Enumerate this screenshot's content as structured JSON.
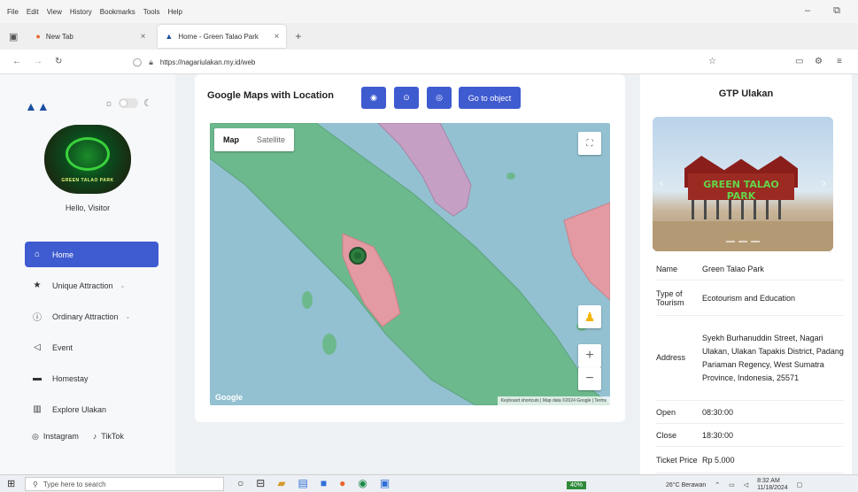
{
  "browser": {
    "menu": [
      "File",
      "Edit",
      "View",
      "History",
      "Bookmarks",
      "Tools",
      "Help"
    ],
    "tabs": [
      {
        "label": "New Tab",
        "active": false
      },
      {
        "label": "Home - Green Talao Park",
        "active": true
      }
    ],
    "url": "https://nagariulakan.my.id/web"
  },
  "sidebar": {
    "greeting": "Hello, Visitor",
    "avatar_text": "GREEN TALAO PARK",
    "nav": [
      {
        "label": "Home",
        "icon": "home-icon",
        "active": true
      },
      {
        "label": "Unique Attraction",
        "icon": "star-icon",
        "has_submenu": true
      },
      {
        "label": "Ordinary Attraction",
        "icon": "info-icon",
        "has_submenu": true
      },
      {
        "label": "Event",
        "icon": "megaphone-icon"
      },
      {
        "label": "Homestay",
        "icon": "bed-icon"
      },
      {
        "label": "Explore Ulakan",
        "icon": "map-icon"
      }
    ],
    "social": {
      "instagram": "Instagram",
      "tiktok": "TikTok"
    }
  },
  "main": {
    "title": "Google Maps with Location",
    "goto_label": "Go to object",
    "map": {
      "type_map": "Map",
      "type_satellite": "Satellite",
      "google": "Google",
      "attribution": "Keyboard shortcuts  |  Map data ©2024 Google  |  Terms"
    }
  },
  "detail": {
    "title": "GTP Ulakan",
    "photo_sign": "GREEN TALAO PARK",
    "rows": [
      {
        "key": "Name",
        "value": "Green Talao Park"
      },
      {
        "key": "Type of Tourism",
        "value": "Ecotourism and Education"
      },
      {
        "key": "Address",
        "value": "Syekh Burhanuddin Street, Nagari Ulakan, Ulakan Tapakis District, Padang Pariaman Regency, West Sumatra Province, Indonesia, 25571"
      },
      {
        "key": "Open",
        "value": "08:30:00"
      },
      {
        "key": "Close",
        "value": "18:30:00"
      },
      {
        "key": "Ticket Price",
        "value": "Rp 5.000"
      }
    ]
  },
  "taskbar": {
    "search_placeholder": "Type here to search",
    "weather": "26°C Berawan",
    "time": "8:32 AM",
    "date": "11/18/2024",
    "battery": "40%"
  },
  "colors": {
    "accent": "#3f5bd0",
    "land": "#67b88a",
    "water": "#93c1d1",
    "highlight": "#e39aa3"
  }
}
